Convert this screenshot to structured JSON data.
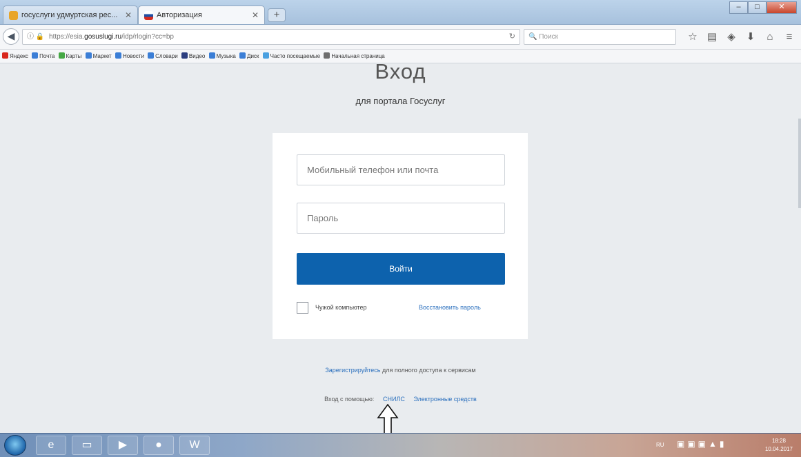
{
  "browser": {
    "tabs": [
      {
        "label": "госуслуги удмуртская рес...",
        "active": false,
        "favicon_color": "#e8a52a"
      },
      {
        "label": "Авторизация",
        "active": true,
        "favicon_color": "#1e4fa3"
      }
    ],
    "new_tab_icon": "plus-icon",
    "window_buttons": {
      "minimize": "–",
      "maximize": "□",
      "close": "✕"
    },
    "url": {
      "prefix": "https://esia.",
      "host": "gosuslugi.ru",
      "path": "/idp/rlogin?cc=bp"
    },
    "search_placeholder": "Поиск",
    "toolbar_icons": [
      "star-icon",
      "clipboard-icon",
      "pocket-icon",
      "download-icon",
      "home-icon",
      "menu-icon"
    ],
    "bookmarks": [
      {
        "label": "Яндекс",
        "color": "#d9261c"
      },
      {
        "label": "Почта",
        "color": "#3b7ed6"
      },
      {
        "label": "Карты",
        "color": "#45a845"
      },
      {
        "label": "Маркет",
        "color": "#3b7ed6"
      },
      {
        "label": "Новости",
        "color": "#3b7ed6"
      },
      {
        "label": "Словари",
        "color": "#3b7ed6"
      },
      {
        "label": "Видео",
        "color": "#2c3e80"
      },
      {
        "label": "Музыка",
        "color": "#3b7ed6"
      },
      {
        "label": "Диск",
        "color": "#3b7ed6"
      },
      {
        "label": "Часто посещаемые",
        "color": "#4aa0e0"
      },
      {
        "label": "Начальная страница",
        "color": "#6e6e6e"
      }
    ]
  },
  "page": {
    "title": "Вход",
    "subtitle": "для портала Госуслуг",
    "form": {
      "phone_placeholder": "Мобильный телефон или почта",
      "password_placeholder": "Пароль",
      "login_button": "Войти",
      "foreign_computer_label": "Чужой компьютер",
      "recover_link": "Восстановить пароль"
    },
    "register": {
      "link": "Зарегистрируйтесь",
      "text": " для полного доступа к сервисам"
    },
    "alt_login": {
      "label": "Вход с помощью:",
      "options": [
        "СНИЛС",
        "Электронные средств"
      ]
    },
    "accent_color": "#0d62ad"
  },
  "taskbar": {
    "apps": [
      "ie-icon",
      "explorer-icon",
      "media-player-icon",
      "firefox-icon",
      "word-icon"
    ],
    "lang": "RU",
    "time": "18:28",
    "date": "10.04.2017"
  }
}
